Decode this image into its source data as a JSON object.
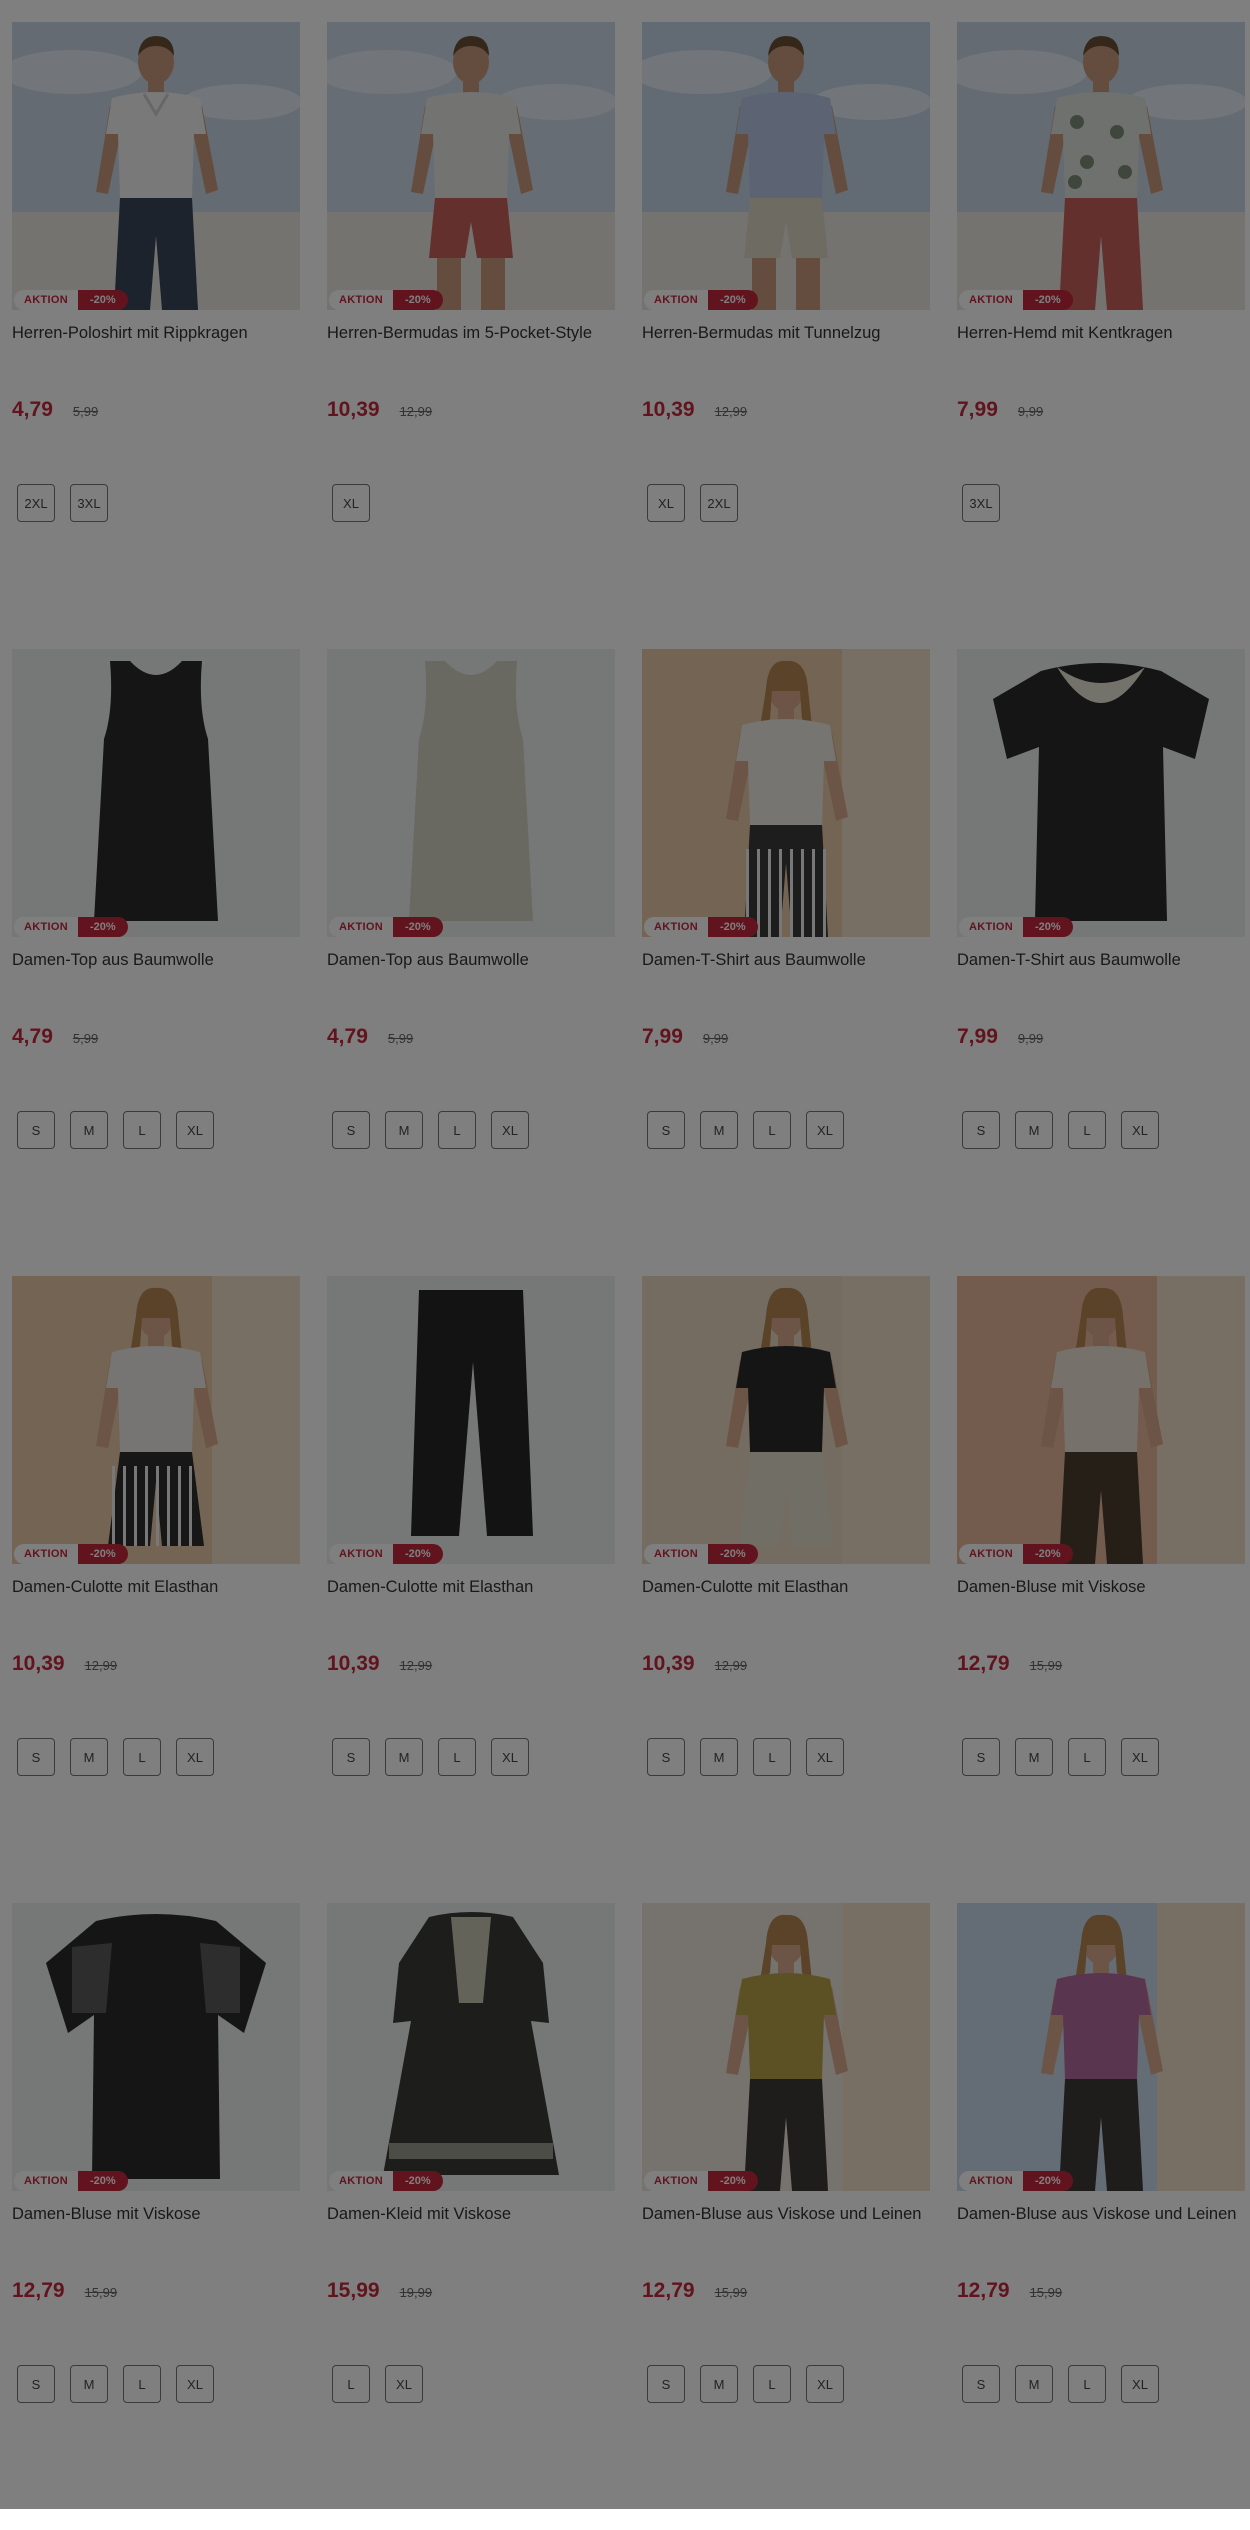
{
  "products": [
    {
      "name": "Herren-Poloshirt mit Rippkragen",
      "price": "4,79",
      "old_price": "5,99",
      "badge": "AKTION",
      "discount": "-20%",
      "sizes": [
        "2XL",
        "3XL"
      ],
      "image": "man-polo-white",
      "colors": {
        "bg": "#c8d7e6",
        "top": "#f2f2f2",
        "bottom": "#39465a",
        "skin": "#c99b7c"
      }
    },
    {
      "name": "Herren-Bermudas im 5-Pocket-Style",
      "price": "10,39",
      "old_price": "12,99",
      "badge": "AKTION",
      "discount": "-20%",
      "sizes": [
        "XL"
      ],
      "image": "man-bermudas-red",
      "colors": {
        "bg": "#cfdbe8",
        "top": "#e6e8e4",
        "bottom": "#c8605a",
        "skin": "#c99b7c"
      }
    },
    {
      "name": "Herren-Bermudas mit Tunnelzug",
      "price": "10,39",
      "old_price": "12,99",
      "badge": "AKTION",
      "discount": "-20%",
      "sizes": [
        "XL",
        "2XL"
      ],
      "image": "man-bermudas-beige",
      "colors": {
        "bg": "#c5d5e6",
        "top": "#b8c8e8",
        "bottom": "#ddd6c6",
        "skin": "#c99b7c"
      }
    },
    {
      "name": "Herren-Hemd mit Kentkragen",
      "price": "7,99",
      "old_price": "9,99",
      "badge": "AKTION",
      "discount": "-20%",
      "sizes": [
        "3XL"
      ],
      "image": "man-shirt-floral",
      "colors": {
        "bg": "#c8d7e6",
        "top": "#dfe3dc",
        "bottom": "#c8605a",
        "skin": "#c99b7c"
      }
    },
    {
      "name": "Damen-Top aus Baumwolle",
      "price": "4,79",
      "old_price": "5,99",
      "badge": "AKTION",
      "discount": "-20%",
      "sizes": [
        "S",
        "M",
        "L",
        "XL"
      ],
      "image": "tank-top-black",
      "colors": {
        "bg": "#eceeef",
        "top": "#2b2b2d"
      }
    },
    {
      "name": "Damen-Top aus Baumwolle",
      "price": "4,79",
      "old_price": "5,99",
      "badge": "AKTION",
      "discount": "-20%",
      "sizes": [
        "S",
        "M",
        "L",
        "XL"
      ],
      "image": "tank-top-beige",
      "colors": {
        "bg": "#eceeef",
        "top": "#d3d0c2"
      }
    },
    {
      "name": "Damen-T-Shirt aus Baumwolle",
      "price": "7,99",
      "old_price": "9,99",
      "badge": "AKTION",
      "discount": "-20%",
      "sizes": [
        "S",
        "M",
        "L",
        "XL"
      ],
      "image": "woman-tshirt-beige",
      "colors": {
        "bg": "#e8c9a8",
        "top": "#eceae4",
        "bottom": "#3a3a3a",
        "skin": "#d8ab8c"
      }
    },
    {
      "name": "Damen-T-Shirt aus Baumwolle",
      "price": "7,99",
      "old_price": "9,99",
      "badge": "AKTION",
      "discount": "-20%",
      "sizes": [
        "S",
        "M",
        "L",
        "XL"
      ],
      "image": "tshirt-black-lace",
      "colors": {
        "bg": "#eceeef",
        "top": "#2a2a2c"
      }
    },
    {
      "name": "Damen-Culotte mit Elasthan",
      "price": "10,39",
      "old_price": "12,99",
      "badge": "AKTION",
      "discount": "-20%",
      "sizes": [
        "S",
        "M",
        "L",
        "XL"
      ],
      "image": "woman-culotte-striped",
      "colors": {
        "bg": "#e6c8a6",
        "top": "#ecebe6",
        "bottom": "#2e2e2e",
        "skin": "#d8ab8c"
      }
    },
    {
      "name": "Damen-Culotte mit Elasthan",
      "price": "10,39",
      "old_price": "12,99",
      "badge": "AKTION",
      "discount": "-20%",
      "sizes": [
        "S",
        "M",
        "L",
        "XL"
      ],
      "image": "culotte-black",
      "colors": {
        "bg": "#eceeef",
        "bottom": "#262628"
      }
    },
    {
      "name": "Damen-Culotte mit Elasthan",
      "price": "10,39",
      "old_price": "12,99",
      "badge": "AKTION",
      "discount": "-20%",
      "sizes": [
        "S",
        "M",
        "L",
        "XL"
      ],
      "image": "woman-culotte-beige",
      "colors": {
        "bg": "#e9d8c0",
        "top": "#2a2a2c",
        "bottom": "#e3dccb",
        "skin": "#d8ab8c"
      }
    },
    {
      "name": "Damen-Bluse mit Viskose",
      "price": "12,79",
      "old_price": "15,99",
      "badge": "AKTION",
      "discount": "-20%",
      "sizes": [
        "S",
        "M",
        "L",
        "XL"
      ],
      "image": "woman-blouse-beige",
      "colors": {
        "bg": "#e6b89a",
        "top": "#ece4d6",
        "bottom": "#4a3e30",
        "skin": "#d8ab8c"
      }
    },
    {
      "name": "Damen-Bluse mit Viskose",
      "price": "12,79",
      "old_price": "15,99",
      "badge": "AKTION",
      "discount": "-20%",
      "sizes": [
        "S",
        "M",
        "L",
        "XL"
      ],
      "image": "blouse-black",
      "colors": {
        "bg": "#eceeef",
        "top": "#2a2a2c"
      }
    },
    {
      "name": "Damen-Kleid mit Viskose",
      "price": "15,99",
      "old_price": "19,99",
      "badge": "AKTION",
      "discount": "-20%",
      "sizes": [
        "L",
        "XL"
      ],
      "image": "dress-dark-green",
      "colors": {
        "bg": "#eceeef",
        "top": "#3b3d37"
      }
    },
    {
      "name": "Damen-Bluse aus Viskose und Leinen",
      "price": "12,79",
      "old_price": "15,99",
      "badge": "AKTION",
      "discount": "-20%",
      "sizes": [
        "S",
        "M",
        "L",
        "XL"
      ],
      "image": "woman-blouse-mustard",
      "colors": {
        "bg": "#ece6dc",
        "top": "#b8a24a",
        "bottom": "#3c3a36",
        "skin": "#d8ab8c"
      }
    },
    {
      "name": "Damen-Bluse aus Viskose und Leinen",
      "price": "12,79",
      "old_price": "15,99",
      "badge": "AKTION",
      "discount": "-20%",
      "sizes": [
        "S",
        "M",
        "L",
        "XL"
      ],
      "image": "woman-blouse-purple",
      "colors": {
        "bg": "#c9d9ea",
        "top": "#b46a9e",
        "bottom": "#3c3a36",
        "skin": "#d8ab8c"
      }
    }
  ]
}
